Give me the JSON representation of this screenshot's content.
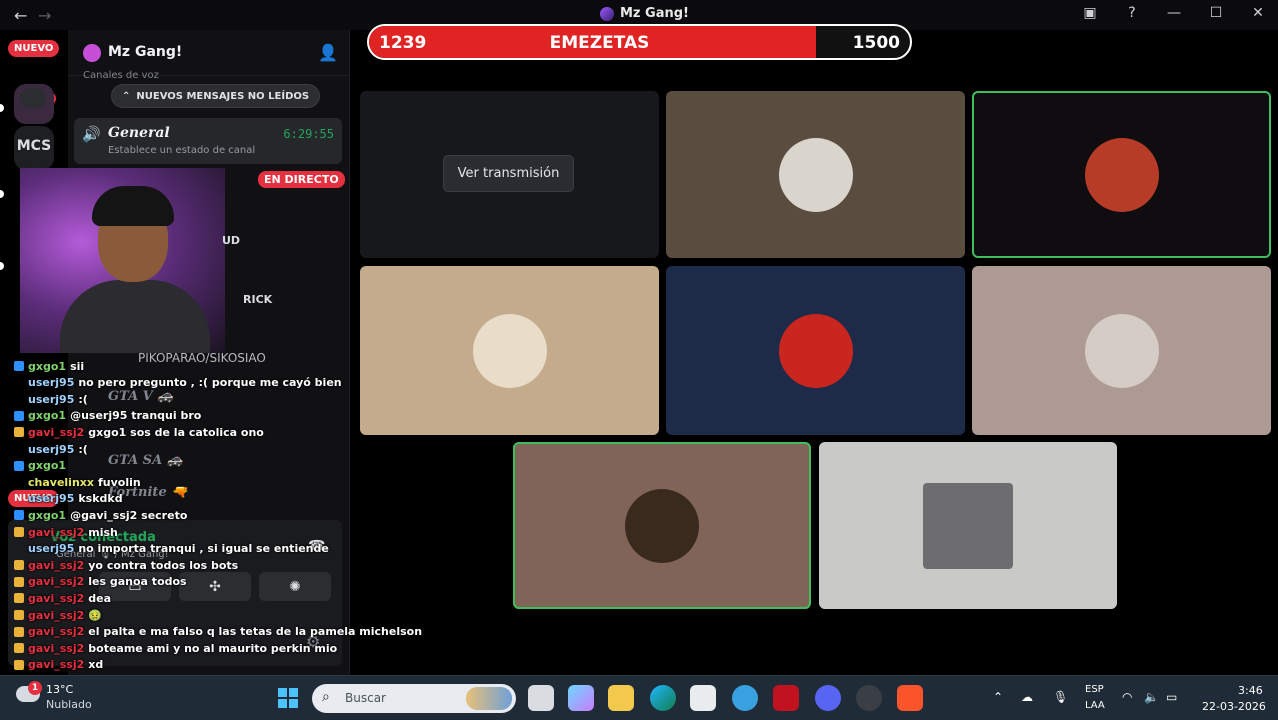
{
  "window": {
    "title": "Mz Gang!",
    "nav_back": "←",
    "nav_forward": "→"
  },
  "rail": {
    "new_badge_top": "NUEVO",
    "mention_count": "10",
    "server_mcs": "MCS",
    "new_badge_bottom": "NUEVO"
  },
  "server": {
    "name": "Mz Gang!",
    "category": "Canales de voz",
    "unread_pill": "NUEVOS MENSAJES NO LEÍDOS",
    "voice_channel": {
      "name": "General",
      "timer": "6:29:55",
      "status": "Establece un estado de canal"
    },
    "ghost_channels": [
      "GTA V 🚓",
      "GTA SA 🚓",
      "Fortnite 🔫"
    ]
  },
  "stream": {
    "live_badge": "EN DIRECTO",
    "side_fragments": [
      "UD",
      "RICK"
    ],
    "chat_header_user": "PIKOPARAO/SIKOSIAO"
  },
  "voice_panel": {
    "title": "Voz conectada",
    "subtitle": "General 🎙 / Mz Gang!"
  },
  "chat": [
    {
      "user": "gxgo1",
      "msg": "sii",
      "badge": "blue",
      "color": "green"
    },
    {
      "user": "userj95",
      "msg": "no pero pregunto , :( porque me cayó bien",
      "badge": "none",
      "color": "yellow"
    },
    {
      "user": "userj95",
      "msg": ":(",
      "badge": "none",
      "color": "yellow"
    },
    {
      "user": "gxgo1",
      "msg": "@userj95 tranqui bro",
      "badge": "blue",
      "color": "green"
    },
    {
      "user": "gavi_ssj2",
      "msg": "gxgo1 sos de la catolica ono",
      "badge": "gold",
      "color": "red"
    },
    {
      "user": "userj95",
      "msg": ":(",
      "badge": "none",
      "color": "yellow"
    },
    {
      "user": "gxgo1",
      "msg": "",
      "badge": "blue",
      "color": "green"
    },
    {
      "user": "chavelinxx",
      "msg": "fuvolin",
      "badge": "none",
      "color": "yellow"
    },
    {
      "user": "userj95",
      "msg": "kskdkd",
      "badge": "none",
      "color": "yellow"
    },
    {
      "user": "gxgo1",
      "msg": "@gavi_ssj2 secreto",
      "badge": "blue",
      "color": "green"
    },
    {
      "user": "gavi_ssj2",
      "msg": "mish",
      "badge": "gold",
      "color": "red"
    },
    {
      "user": "userj95",
      "msg": "no importa tranqui , si igual se entiende",
      "badge": "none",
      "color": "yellow"
    },
    {
      "user": "gavi_ssj2",
      "msg": "yo contra todos los bots",
      "badge": "gold",
      "color": "red"
    },
    {
      "user": "gavi_ssj2",
      "msg": "les ganoa todos",
      "badge": "gold",
      "color": "red"
    },
    {
      "user": "gavi_ssj2",
      "msg": "dea",
      "badge": "gold",
      "color": "red"
    },
    {
      "user": "gavi_ssj2",
      "msg": "🤢",
      "badge": "gold",
      "color": "red"
    },
    {
      "user": "gavi_ssj2",
      "msg": "el palta e ma falso q las tetas de la pamela michelson",
      "badge": "gold",
      "color": "red"
    },
    {
      "user": "gavi_ssj2",
      "msg": "boteame ami y no al maurito perkin mio",
      "badge": "gold",
      "color": "red"
    },
    {
      "user": "gavi_ssj2",
      "msg": "xd",
      "badge": "gold",
      "color": "red"
    }
  ],
  "scorebar": {
    "current": "1239",
    "label": "EMEZETAS",
    "max": "1500",
    "fraction": 0.826,
    "fill_color": "#e02424"
  },
  "tiles": [
    {
      "bg": "#17181b",
      "speaking": false,
      "watch_label": "Ver transmisión"
    },
    {
      "bg": "#5b4c40",
      "speaking": false,
      "avatar": "#d9d4cc"
    },
    {
      "bg": "#0f0d10",
      "speaking": true,
      "avatar": "#b63c28"
    },
    {
      "bg": "#c4ab8c",
      "speaking": false,
      "avatar": "#e9dcc8"
    },
    {
      "bg": "#1e2b48",
      "speaking": false,
      "avatar": "#c9261f"
    },
    {
      "bg": "#ad9a95",
      "speaking": false,
      "avatar": "#d6ccc6"
    },
    {
      "bg": "#806458",
      "speaking": true,
      "avatar": "#3a2a1e"
    },
    {
      "bg": "#c9c9c7",
      "speaking": false,
      "avatar": "#6d6d70"
    }
  ],
  "taskbar": {
    "weather_badge": "1",
    "temp": "13°C",
    "condition": "Nublado",
    "search_placeholder": "Buscar",
    "lang_top": "ESP",
    "lang_bottom": "LAA",
    "time": "3:46",
    "date": "22-03-2026"
  }
}
